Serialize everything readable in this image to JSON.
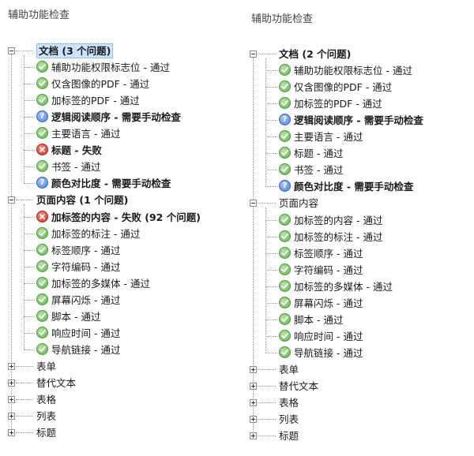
{
  "colors": {
    "pass": "#5fb24a",
    "fail": "#cf2f22",
    "manual": "#4a7fe0",
    "selection": "#cde3fb"
  },
  "left": {
    "title": "辅助功能检查",
    "document": {
      "label": "文档 (3 个问题)",
      "items": [
        {
          "label": "辅助功能权限标志位 - 通过",
          "status": "pass",
          "icon": "check-icon"
        },
        {
          "label": "仅含图像的PDF - 通过",
          "status": "pass",
          "icon": "check-icon"
        },
        {
          "label": "加标签的PDF - 通过",
          "status": "pass",
          "icon": "check-icon"
        },
        {
          "label": "逻辑阅读顺序 - 需要手动检查",
          "status": "manual",
          "icon": "question-icon"
        },
        {
          "label": "主要语言 - 通过",
          "status": "pass",
          "icon": "check-icon"
        },
        {
          "label": "标题 - 失败",
          "status": "fail",
          "icon": "x-icon"
        },
        {
          "label": "书签 - 通过",
          "status": "pass",
          "icon": "check-icon"
        },
        {
          "label": "颜色对比度 - 需要手动检查",
          "status": "manual",
          "icon": "question-icon"
        }
      ]
    },
    "page_content": {
      "label": "页面内容 (1 个问题)",
      "items": [
        {
          "label": "加标签的内容 - 失败 (92 个问题)",
          "status": "fail",
          "icon": "x-icon"
        },
        {
          "label": "加标签的标注 - 通过",
          "status": "pass",
          "icon": "check-icon"
        },
        {
          "label": "标签顺序 - 通过",
          "status": "pass",
          "icon": "check-icon"
        },
        {
          "label": "字符编码 - 通过",
          "status": "pass",
          "icon": "check-icon"
        },
        {
          "label": "加标签的多媒体 - 通过",
          "status": "pass",
          "icon": "check-icon"
        },
        {
          "label": "屏幕闪烁 - 通过",
          "status": "pass",
          "icon": "check-icon"
        },
        {
          "label": "脚本 - 通过",
          "status": "pass",
          "icon": "check-icon"
        },
        {
          "label": "响应时间 - 通过",
          "status": "pass",
          "icon": "check-icon"
        },
        {
          "label": "导航链接 - 通过",
          "status": "pass",
          "icon": "check-icon"
        }
      ]
    },
    "collapsed": [
      "表单",
      "替代文本",
      "表格",
      "列表",
      "标题"
    ]
  },
  "right": {
    "title": "辅助功能检查",
    "document": {
      "label": "文档 (2 个问题)",
      "items": [
        {
          "label": "辅助功能权限标志位 - 通过",
          "status": "pass",
          "icon": "check-icon"
        },
        {
          "label": "仅含图像的PDF - 通过",
          "status": "pass",
          "icon": "check-icon"
        },
        {
          "label": "加标签的PDF - 通过",
          "status": "pass",
          "icon": "check-icon"
        },
        {
          "label": "逻辑阅读顺序 - 需要手动检查",
          "status": "manual",
          "icon": "question-icon"
        },
        {
          "label": "主要语言 - 通过",
          "status": "pass",
          "icon": "check-icon"
        },
        {
          "label": "标题 - 通过",
          "status": "pass",
          "icon": "check-icon"
        },
        {
          "label": "书签 - 通过",
          "status": "pass",
          "icon": "check-icon"
        },
        {
          "label": "颜色对比度 - 需要手动检查",
          "status": "manual",
          "icon": "question-icon"
        }
      ]
    },
    "page_content": {
      "label": "页面内容",
      "items": [
        {
          "label": "加标签的内容 - 通过",
          "status": "pass",
          "icon": "check-icon"
        },
        {
          "label": "加标签的标注 - 通过",
          "status": "pass",
          "icon": "check-icon"
        },
        {
          "label": "标签顺序 - 通过",
          "status": "pass",
          "icon": "check-icon"
        },
        {
          "label": "字符编码 - 通过",
          "status": "pass",
          "icon": "check-icon"
        },
        {
          "label": "加标签的多媒体 - 通过",
          "status": "pass",
          "icon": "check-icon"
        },
        {
          "label": "屏幕闪烁 - 通过",
          "status": "pass",
          "icon": "check-icon"
        },
        {
          "label": "脚本 - 通过",
          "status": "pass",
          "icon": "check-icon"
        },
        {
          "label": "响应时间 - 通过",
          "status": "pass",
          "icon": "check-icon"
        },
        {
          "label": "导航链接 - 通过",
          "status": "pass",
          "icon": "check-icon"
        }
      ]
    },
    "collapsed": [
      "表单",
      "替代文本",
      "表格",
      "列表",
      "标题"
    ]
  }
}
